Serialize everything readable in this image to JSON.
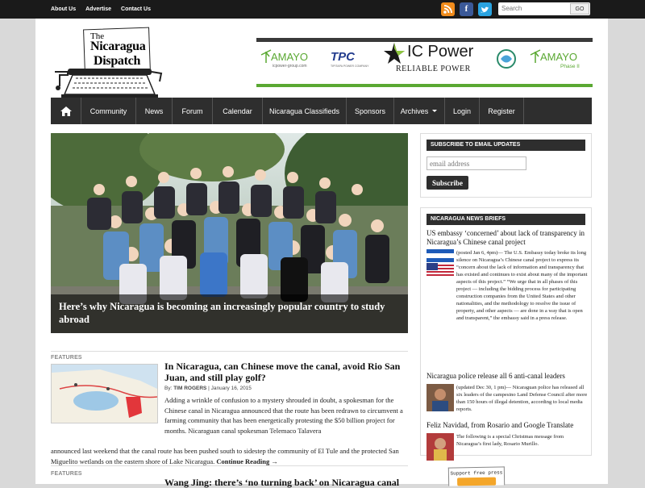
{
  "topbar": {
    "links": [
      "About Us",
      "Advertise",
      "Contact Us"
    ],
    "search_placeholder": "Search",
    "search_button": "GO",
    "social": {
      "facebook": "f"
    }
  },
  "logo": {
    "line1": "The",
    "line2": "Nicaragua",
    "line3": "Dispatch"
  },
  "banner": {
    "amayo_left": "AMAYO",
    "amayo_url": "icpower-group.com",
    "tpc": "TPC",
    "tpc_sub": "TIPITAPA POWER COMPANY",
    "brand": "IC Power",
    "tagline": "RELIABLE POWER",
    "amayo_right": "AMAYO",
    "phase": "Phase II"
  },
  "nav": {
    "items": [
      "Community",
      "News",
      "Forum",
      "Calendar",
      "Nicaragua Classifieds",
      "Sponsors",
      "Archives",
      "Login",
      "Register"
    ]
  },
  "hero": {
    "caption": "Here’s why Nicaragua is becoming an increasingly popular country to study abroad"
  },
  "articles": [
    {
      "section": "FEATURES",
      "title": "In Nicaragua, can Chinese move the canal, avoid Rio San Juan, and still play golf?",
      "by_prefix": "By: ",
      "author": "TIM ROGERS",
      "date": " | January 16, 2015",
      "body": "Adding a wrinkle of confusion to a mystery shrouded in doubt, a spokesman for the Chinese canal in Nicaragua announced that the route has been redrawn to circumvent a farming community that has been energetically protesting the $50 billion project for months. Nicaraguan canal spokesman Telemaco Talavera",
      "body_full": "announced last weekend that the canal route has been pushed south to sidestep the community of El Tule and the protected San Miguelito wetlands on the eastern shore of Lake Nicaragua.",
      "more": "Continue Reading →"
    },
    {
      "section": "FEATURES",
      "title": "Wang Jing: there’s ‘no turning back’ on Nicaragua canal"
    }
  ],
  "sidebar": {
    "email": {
      "title": "SUBSCRIBE TO EMAIL UPDATES",
      "placeholder": "email address",
      "button": "Subscribe"
    },
    "briefs": {
      "title": "NICARAGUA NEWS BRIEFS",
      "items": [
        {
          "headline": "US embassy ‘concerned’ about lack of transparency in Nicaragua’s Chinese canal project",
          "body": "(posted Jan 6, 4pm)— The U.S. Embassy today broke its long silence on Nicaragua’s Chinese canal project to express its “concern about the lack of information and transparency that has existed and continues to exist about many of the important aspects of this project.” “We urge that in all phases of this project — including the bidding process for participating construction companies from the United States and other nationalities, and the methodology to resolve the issue of property, and other aspects — are done in a way that is open and transparent,” the embassy said in a press release."
        },
        {
          "headline": "Nicaragua police release all 6 anti-canal leaders",
          "body": "(updated Dec 30, 1 pm)— Nicaraguan police has released all six leaders of the campesino Land Defense Council after more than 150 hours of illegal detention, according to local media reports."
        },
        {
          "headline": "Feliz Navidad, from Rosario and Google Translate",
          "body": "The following is a special Christmas message from Nicaragua’s first lady, Rosario Murillo."
        }
      ]
    },
    "support": "Support free press"
  }
}
